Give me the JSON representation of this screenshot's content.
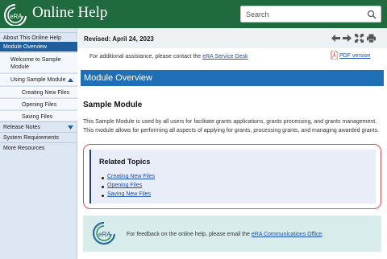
{
  "header": {
    "logo_text": "eRA",
    "title": "Online Help",
    "search_placeholder": "Search",
    "colors": {
      "bar": "#1f6a3e",
      "nav_active": "#1f5e9c",
      "overview_bar": "#1f6fb6"
    }
  },
  "sidebar": {
    "items": [
      {
        "label": "About This Online Help"
      },
      {
        "label": "Module Overview"
      },
      {
        "label": "Welcome to Sample Module"
      },
      {
        "label": "Using Sample Module"
      },
      {
        "label": "Creating New Files"
      },
      {
        "label": "Opening Files"
      },
      {
        "label": "Saving Files"
      },
      {
        "label": "Release Notes"
      },
      {
        "label": "System Requirements"
      },
      {
        "label": "More Resources"
      }
    ]
  },
  "toolbar": {
    "revised": "Revised: April 24, 2023",
    "icons": [
      "arrow-left-icon",
      "arrow-right-icon",
      "expand-icon",
      "print-icon"
    ]
  },
  "assist": {
    "prefix": "For additional assistance, please contact the ",
    "link": "eRA Service Desk"
  },
  "pdf_link": "PDF version",
  "overview_title": "Module Overview",
  "sample": {
    "heading": "Sample Module",
    "body": "This Sample Module is used by all users for facilitate grants applications, grants processing, and grants management. This module allows for performing all aspects of applying for grants, processing grants, and managing awarded grants."
  },
  "related": {
    "heading": "Related Topics",
    "links": [
      "Creating New Files",
      "Opening Files",
      "Saving New Files"
    ]
  },
  "feedback": {
    "logo_text": "eRA",
    "prefix": "For feedback on the online help, please email the ",
    "link": "eRA Communications Office",
    "suffix": "."
  }
}
